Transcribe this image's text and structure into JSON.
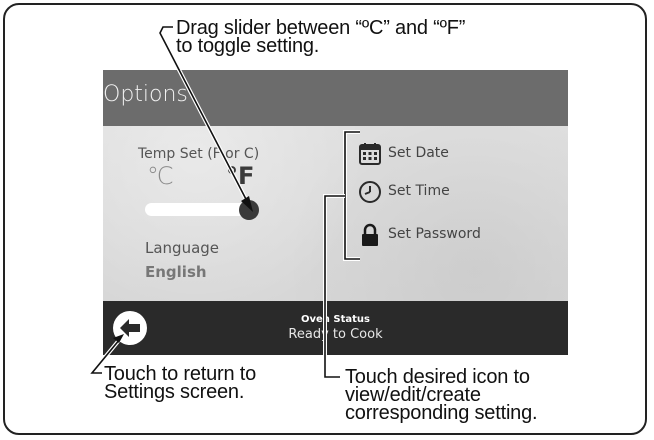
{
  "callouts": {
    "slider_line1": "Drag slider between “ºC” and “ºF”",
    "slider_line2": "to toggle setting.",
    "back_line1": "Touch to return to",
    "back_line2": "Settings screen.",
    "icon_line1": "Touch desired icon to",
    "icon_line2": "view/edit/create",
    "icon_line3": "corresponding setting."
  },
  "screen": {
    "title": "Options",
    "temp_set": {
      "label": "Temp Set (F or C)",
      "unit_c": "℃",
      "unit_f": "°F",
      "selected": "F"
    },
    "language": {
      "label": "Language",
      "value": "English"
    },
    "settings": [
      {
        "icon": "calendar-icon",
        "label": "Set Date"
      },
      {
        "icon": "clock-icon",
        "label": "Set Time"
      },
      {
        "icon": "lock-icon",
        "label": "Set Password"
      }
    ],
    "status": {
      "title": "Oven Status",
      "value": "Ready to Cook"
    }
  },
  "colors": {
    "titlebar": "#6c6c6c",
    "statusbar": "#2a2a2a",
    "screen_bg": "#dcdcdc"
  }
}
